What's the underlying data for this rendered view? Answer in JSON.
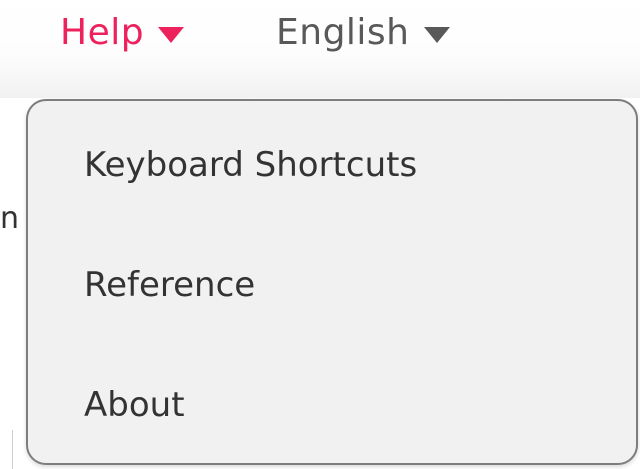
{
  "menubar": {
    "help_label": "Help",
    "language_label": "English"
  },
  "dropdown": {
    "items": [
      {
        "label": "Keyboard Shortcuts"
      },
      {
        "label": "Reference"
      },
      {
        "label": "About"
      }
    ]
  },
  "background": {
    "glyph": "n"
  },
  "colors": {
    "accent": "#ed225d",
    "text": "#333333",
    "muted": "#595959",
    "dropdown_bg": "#f1f1f1",
    "dropdown_border": "#7d7d7d"
  },
  "icons": {
    "help_caret": "caret-down-icon",
    "language_caret": "caret-down-icon"
  }
}
